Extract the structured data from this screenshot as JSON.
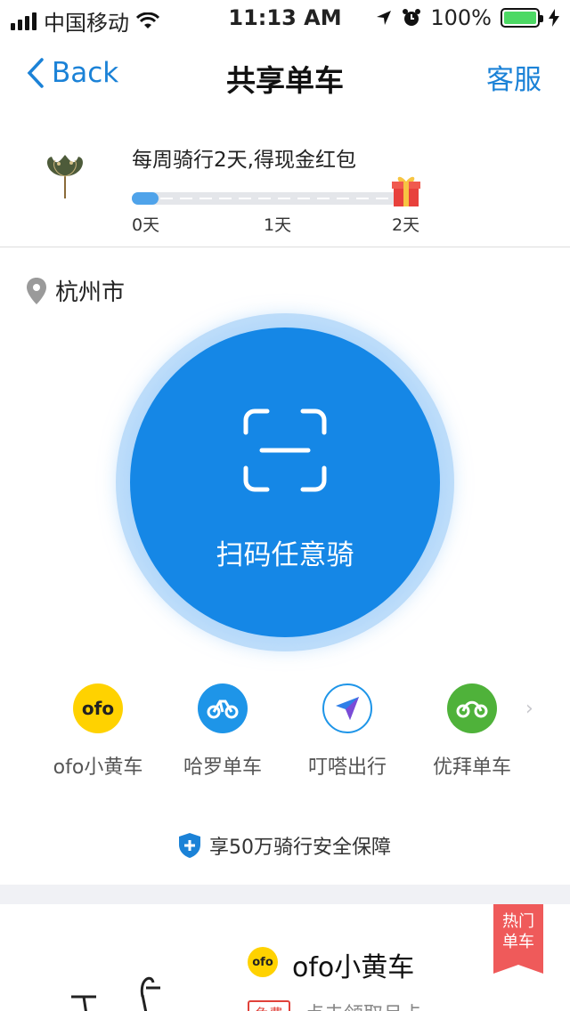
{
  "status_bar": {
    "carrier": "中国移动",
    "time": "11:13 AM",
    "battery": "100%",
    "icons": [
      "signal-icon",
      "wifi-icon",
      "location-arrow-icon",
      "alarm-icon",
      "battery-icon",
      "charging-icon"
    ]
  },
  "nav": {
    "back_label": "Back",
    "title": "共享单车",
    "right_label": "客服"
  },
  "promo": {
    "text": "每周骑行2天,得现金红包",
    "progress_days": 0,
    "max_days": 2,
    "ticks": [
      "0天",
      "1天",
      "2天"
    ],
    "gift_icon": "gift-icon"
  },
  "location": {
    "city": "杭州市",
    "icon": "location-pin-icon"
  },
  "scan": {
    "label": "扫码任意骑",
    "icon": "scan-frame-icon",
    "color": "#1587e6"
  },
  "brands": [
    {
      "label": "ofo小黄车",
      "logo_text": "ofo",
      "color": "#ffd200"
    },
    {
      "label": "哈罗单车",
      "color": "#1e95e8"
    },
    {
      "label": "叮嗒出行",
      "color": "#ffffff"
    },
    {
      "label": "优拜单车",
      "color": "#4fb23a"
    }
  ],
  "safety": {
    "text": "享50万骑行安全保障",
    "icon": "shield-plus-icon"
  },
  "card": {
    "logo_text": "ofo",
    "name": "ofo小黄车",
    "tag": "免费",
    "sub": "点击领取月卡",
    "hot_badge": "热门单车"
  }
}
